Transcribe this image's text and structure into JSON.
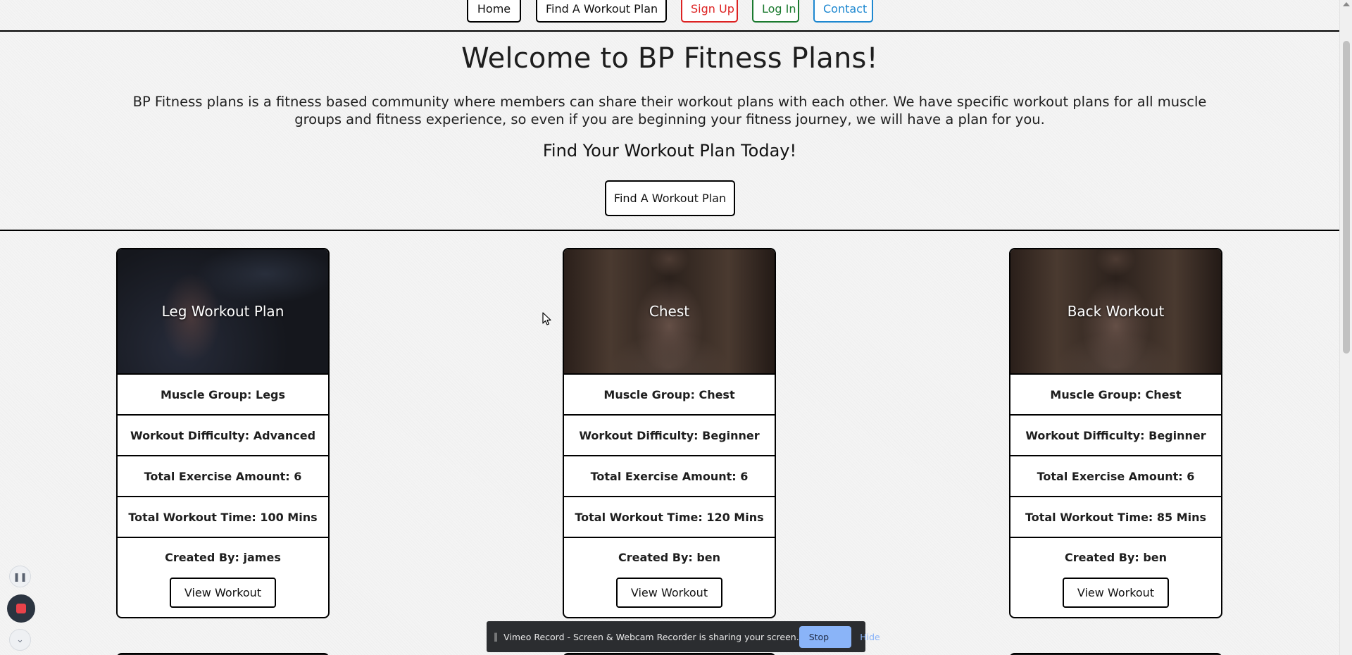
{
  "nav": {
    "home": "Home",
    "find": "Find A Workout Plan",
    "signup": "Sign Up",
    "login": "Log In",
    "contact": "Contact"
  },
  "hero": {
    "title": "Welcome to BP Fitness Plans!",
    "description": "BP Fitness plans is a fitness based community where members can share their workout plans with each other. We have specific workout plans for all muscle groups and fitness experience, so even if you are beginning your fitness journey, we will have a plan for you.",
    "subtitle": "Find Your Workout Plan Today!",
    "button": "Find A Workout Plan"
  },
  "cards": [
    {
      "title": "Leg Workout Plan",
      "muscle_group": "Muscle Group: Legs",
      "difficulty": "Workout Difficulty: Advanced",
      "exercise_amount": "Total Exercise Amount: 6",
      "workout_time": "Total Workout Time: 100 Mins",
      "created_by": "Created By: james",
      "button": "View Workout"
    },
    {
      "title": "Chest",
      "muscle_group": "Muscle Group: Chest",
      "difficulty": "Workout Difficulty: Beginner",
      "exercise_amount": "Total Exercise Amount: 6",
      "workout_time": "Total Workout Time: 120 Mins",
      "created_by": "Created By: ben",
      "button": "View Workout"
    },
    {
      "title": "Back Workout",
      "muscle_group": "Muscle Group: Chest",
      "difficulty": "Workout Difficulty: Beginner",
      "exercise_amount": "Total Exercise Amount: 6",
      "workout_time": "Total Workout Time: 85 Mins",
      "created_by": "Created By: ben",
      "button": "View Workout"
    }
  ],
  "share_bar": {
    "text": "Vimeo Record - Screen & Webcam Recorder is sharing your screen.",
    "stop": "Stop sharing",
    "hide": "Hide"
  },
  "colors": {
    "signup": "#dd2222",
    "login": "#1b7a2f",
    "contact": "#1e88d0",
    "share_button": "#8ab4f8"
  }
}
